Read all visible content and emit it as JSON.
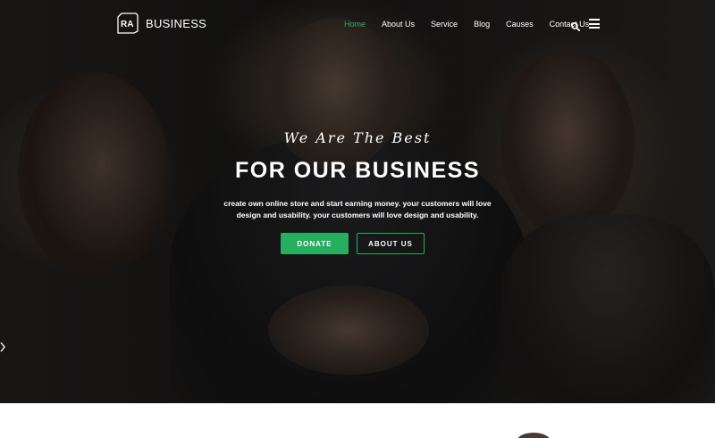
{
  "header": {
    "logo_text": "BUSINESS",
    "logo_mark": "RA",
    "nav": [
      {
        "label": "Home",
        "active": true
      },
      {
        "label": "About Us",
        "active": false
      },
      {
        "label": "Service",
        "active": false
      },
      {
        "label": "Blog",
        "active": false
      },
      {
        "label": "Causes",
        "active": false
      },
      {
        "label": "Contact Us",
        "active": false
      }
    ],
    "icons": [
      "search-icon",
      "hamburger-menu-icon"
    ]
  },
  "hero": {
    "subtitle": "We Are The Best",
    "title": "FOR OUR BUSINESS",
    "description": "create own online store and start earning money. your customers will love design and usability. your customers will love design and usability.",
    "buttons": {
      "donate": "DONATE",
      "about": "ABOUT US"
    },
    "slider_prev_icon": "chevron-left-icon"
  },
  "colors": {
    "accent": "#27ae60",
    "text": "#ffffff"
  }
}
